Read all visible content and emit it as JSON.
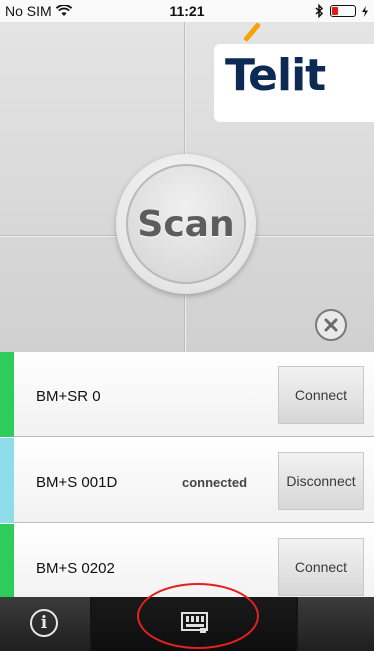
{
  "status_bar": {
    "carrier": "No SIM",
    "time": "11:21"
  },
  "header": {
    "logo_text": "Telit"
  },
  "scan": {
    "label": "Scan"
  },
  "devices": [
    {
      "name": "BM+SR 0",
      "status": "",
      "action": "Connect",
      "indicator_color": "#2ecc5a"
    },
    {
      "name": "BM+S 001D",
      "status": "connected",
      "action": "Disconnect",
      "indicator_color": "#8fdcea"
    },
    {
      "name": "BM+S 0202",
      "status": "",
      "action": "Connect",
      "indicator_color": "#2ecc5a"
    }
  ],
  "tab_bar": {
    "tabs": [
      {
        "icon": "info-icon"
      },
      {
        "icon": "device-icon",
        "selected": true
      }
    ]
  },
  "colors": {
    "accent": "#f5a300",
    "brand": "#0d2a54",
    "highlight": "#e22222"
  }
}
